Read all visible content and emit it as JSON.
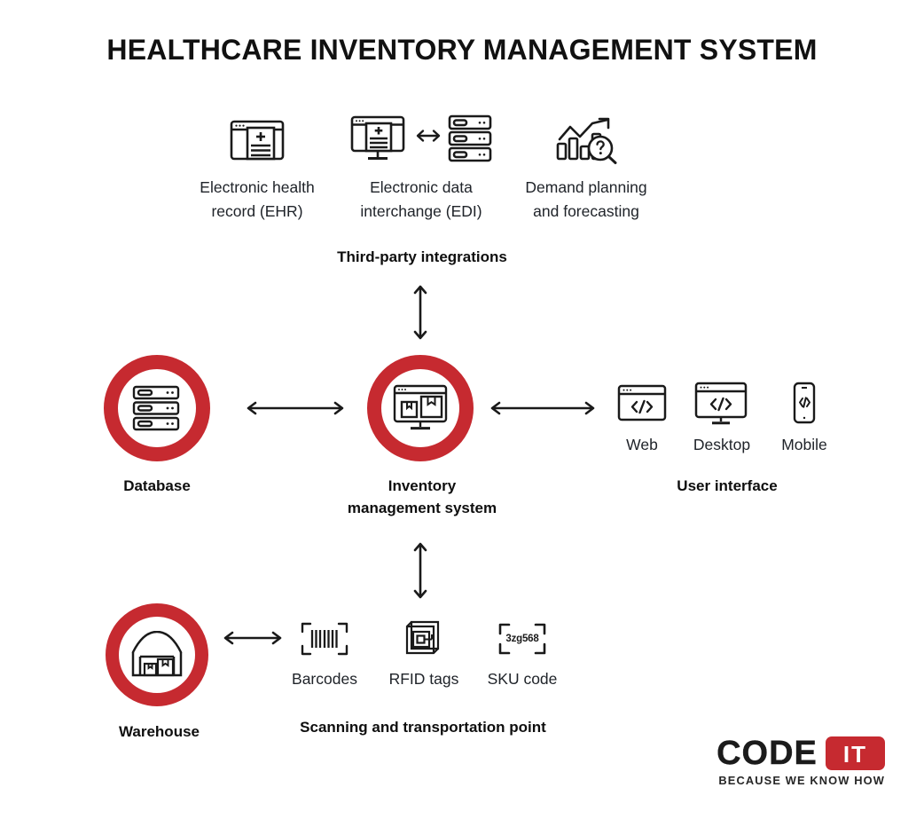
{
  "page": {
    "title": "HEALTHCARE INVENTORY MANAGEMENT SYSTEM",
    "background": "#ffffff",
    "accent_red": "#c62a30",
    "line_color": "#1a1a1a"
  },
  "third_party": {
    "section_label": "Third-party integrations",
    "items": [
      {
        "icon": "browser-medical-record-icon",
        "label": "Electronic health\nrecord (EHR)",
        "line1": "Electronic health",
        "line2": "record (EHR)"
      },
      {
        "icon": "monitor-server-exchange-icon",
        "label": "Electronic data\ninterchange (EDI)",
        "line1": "Electronic data",
        "line2": "interchange (EDI)"
      },
      {
        "icon": "bar-chart-trend-magnifier-icon",
        "label": "Demand planning\nand forecasting",
        "line1": "Demand planning",
        "line2": "and forecasting"
      }
    ]
  },
  "core": {
    "database": {
      "icon": "server-rack-icon",
      "label": "Database"
    },
    "inventory": {
      "icon": "monitor-boxes-icon",
      "line1": "Inventory",
      "line2": "management system"
    },
    "user_interface": {
      "section_label": "User interface",
      "items": [
        {
          "icon": "browser-code-icon",
          "label": "Web"
        },
        {
          "icon": "desktop-code-icon",
          "label": "Desktop"
        },
        {
          "icon": "mobile-code-icon",
          "label": "Mobile"
        }
      ]
    }
  },
  "scanning": {
    "section_label": "Scanning and transportation point",
    "warehouse": {
      "icon": "warehouse-boxes-icon",
      "label": "Warehouse"
    },
    "items": [
      {
        "icon": "barcode-scan-icon",
        "label": "Barcodes"
      },
      {
        "icon": "rfid-tag-icon",
        "label": "RFID tags"
      },
      {
        "icon": "sku-code-scan-icon",
        "label": "SKU code",
        "code_text": "3zg568"
      }
    ]
  },
  "connectors": [
    {
      "name": "third-party-to-inventory",
      "direction": "vertical-double"
    },
    {
      "name": "database-to-inventory",
      "direction": "horizontal-double"
    },
    {
      "name": "inventory-to-user-interface",
      "direction": "horizontal-double"
    },
    {
      "name": "inventory-to-scanning",
      "direction": "vertical-double"
    },
    {
      "name": "warehouse-to-scanning-items",
      "direction": "horizontal-double"
    }
  ],
  "logo": {
    "word_code": "CODE",
    "word_it": "IT",
    "tagline": "BECAUSE WE KNOW HOW"
  }
}
